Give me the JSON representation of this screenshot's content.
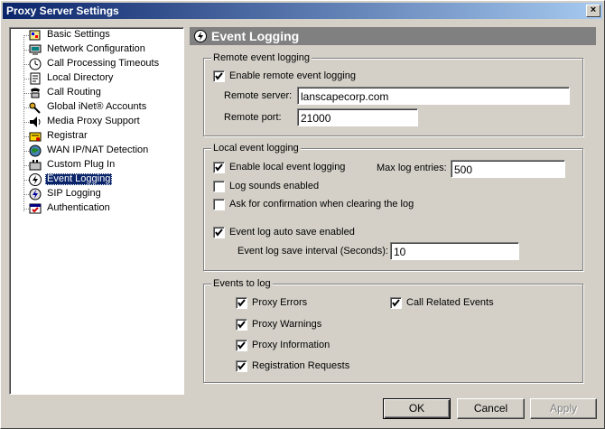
{
  "window": {
    "title": "Proxy Server Settings",
    "close_glyph": "×"
  },
  "tree": {
    "items": [
      {
        "label": "Basic Settings",
        "icon": "basic-settings-icon"
      },
      {
        "label": "Network Configuration",
        "icon": "network-icon"
      },
      {
        "label": "Call Processing Timeouts",
        "icon": "clock-icon"
      },
      {
        "label": "Local Directory",
        "icon": "directory-icon"
      },
      {
        "label": "Call Routing",
        "icon": "phone-icon"
      },
      {
        "label": "Global iNet® Accounts",
        "icon": "key-icon"
      },
      {
        "label": "Media Proxy Support",
        "icon": "speaker-icon"
      },
      {
        "label": "Registrar",
        "icon": "registrar-icon"
      },
      {
        "label": "WAN IP/NAT Detection",
        "icon": "globe-icon"
      },
      {
        "label": "Custom Plug In",
        "icon": "plugin-icon"
      },
      {
        "label": "Event Logging",
        "icon": "event-logging-icon",
        "selected": true
      },
      {
        "label": "SIP Logging",
        "icon": "sip-logging-icon"
      },
      {
        "label": "Authentication",
        "icon": "authentication-icon"
      }
    ]
  },
  "header": {
    "title": "Event Logging"
  },
  "remote": {
    "group_title": "Remote event logging",
    "enable_label": "Enable remote event logging",
    "enable_checked": true,
    "server_label": "Remote server:",
    "server_value": "lanscapecorp.com",
    "port_label": "Remote port:",
    "port_value": "21000"
  },
  "local": {
    "group_title": "Local event logging",
    "enable_label": "Enable local event logging",
    "enable_checked": true,
    "max_label": "Max log entries:",
    "max_value": "500",
    "sounds_label": "Log sounds enabled",
    "sounds_checked": false,
    "confirm_label": "Ask for confirmation when clearing the log",
    "confirm_checked": false,
    "autosave_label": "Event log auto save enabled",
    "autosave_checked": true,
    "interval_label": "Event log save interval (Seconds):",
    "interval_value": "10"
  },
  "events": {
    "group_title": "Events to log",
    "proxy_errors": "Proxy Errors",
    "proxy_warnings": "Proxy Warnings",
    "proxy_information": "Proxy Information",
    "registration_requests": "Registration Requests",
    "call_related": "Call Related Events"
  },
  "buttons": {
    "ok": "OK",
    "cancel": "Cancel",
    "apply": "Apply"
  },
  "colors": {
    "title_start": "#0a246a",
    "title_end": "#a6caf0",
    "selection": "#0a246a",
    "face": "#d4d0c8",
    "header_bg": "#808080"
  }
}
